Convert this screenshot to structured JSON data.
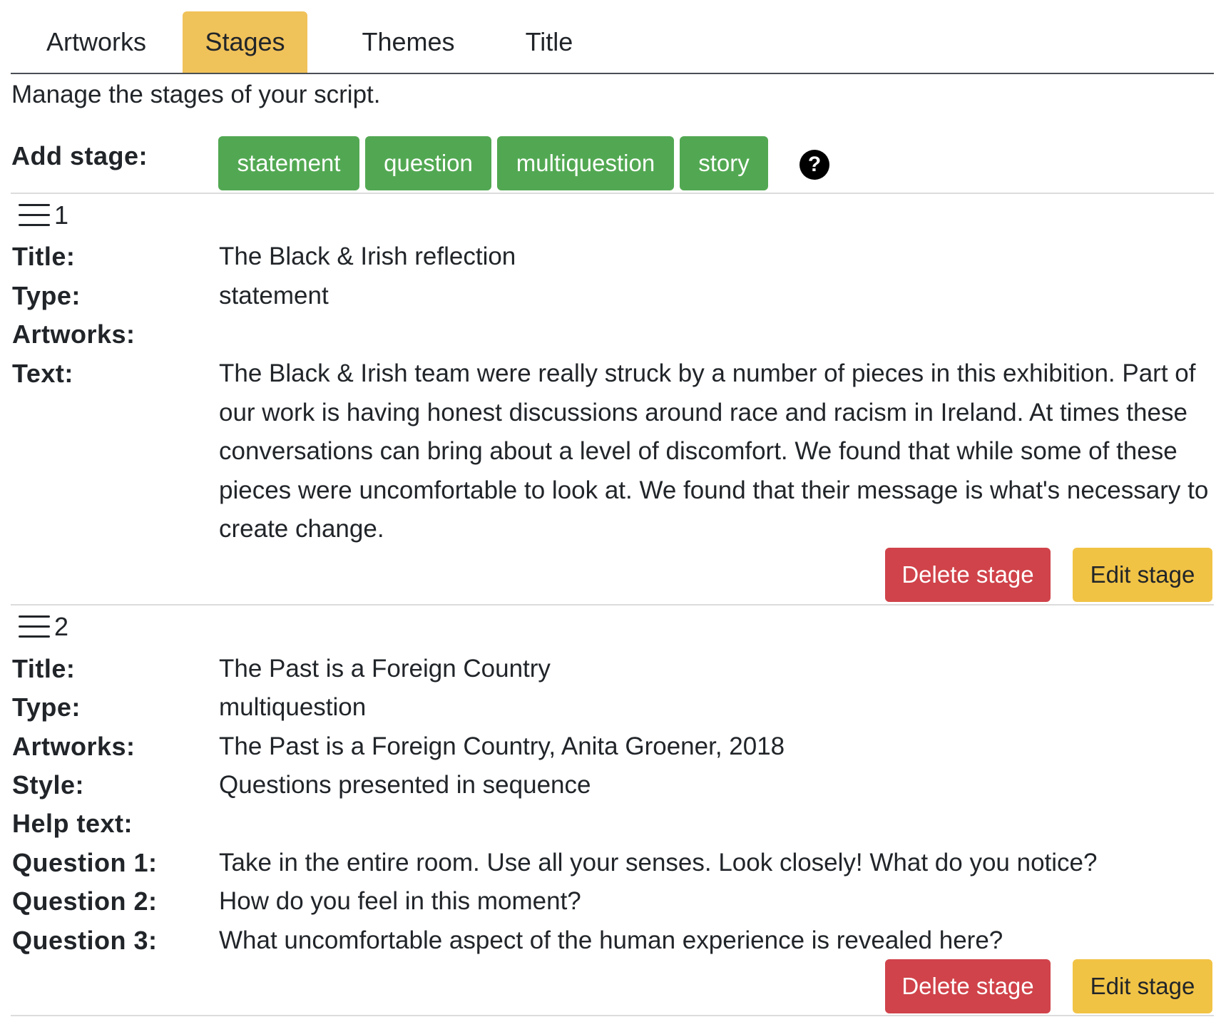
{
  "tabs": [
    {
      "label": "Artworks"
    },
    {
      "label": "Stages"
    },
    {
      "label": "Themes"
    },
    {
      "label": "Title"
    }
  ],
  "description": "Manage the stages of your script.",
  "add_stage": {
    "label": "Add stage:",
    "buttons": [
      "statement",
      "question",
      "multiquestion",
      "story"
    ],
    "help_icon": "?",
    "button_color": "#52a852"
  },
  "colors": {
    "active_tab": "#f0c25a",
    "delete": "#d0434a",
    "edit": "#f1c345"
  },
  "stages": [
    {
      "number": "1",
      "fields": {
        "title": {
          "label": "Title:",
          "value": "The Black & Irish reflection"
        },
        "type": {
          "label": "Type:",
          "value": "statement"
        },
        "artworks": {
          "label": "Artworks:",
          "value": ""
        },
        "text": {
          "label": "Text:",
          "value": "The Black & Irish team were really struck by a number of pieces in this exhibition. Part of our work is having honest discussions around race and racism in Ireland. At times these conversations can bring about a level of discomfort. We found that while some of these pieces were uncomfortable to look at. We found that their message is what's necessary to create change."
        }
      },
      "delete_label": "Delete stage",
      "edit_label": "Edit stage"
    },
    {
      "number": "2",
      "fields": {
        "title": {
          "label": "Title:",
          "value": "The Past is a Foreign Country"
        },
        "type": {
          "label": "Type:",
          "value": "multiquestion"
        },
        "artworks": {
          "label": "Artworks:",
          "value": "The Past is a Foreign Country, Anita Groener, 2018"
        },
        "style": {
          "label": "Style:",
          "value": "Questions presented in sequence"
        },
        "help_text": {
          "label": "Help text:",
          "value": ""
        },
        "q1": {
          "label": "Question 1:",
          "value": "Take in the entire room. Use all your senses. Look closely! What do you notice?"
        },
        "q2": {
          "label": "Question 2:",
          "value": "How do you feel in this moment?"
        },
        "q3": {
          "label": "Question 3:",
          "value": "What uncomfortable aspect of the human experience is revealed here?"
        }
      },
      "delete_label": "Delete stage",
      "edit_label": "Edit stage"
    }
  ]
}
